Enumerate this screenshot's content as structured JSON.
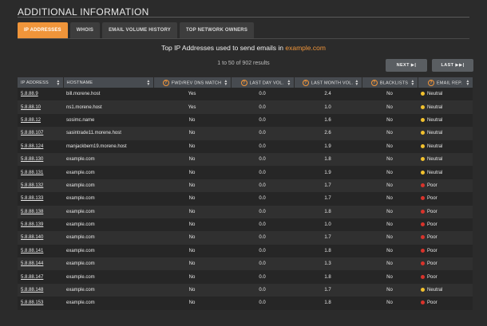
{
  "section_title": "ADDITIONAL INFORMATION",
  "tabs": [
    {
      "label": "IP ADDRESSES",
      "active": true
    },
    {
      "label": "WHOIS",
      "active": false
    },
    {
      "label": "EMAIL VOLUME HISTORY",
      "active": false
    },
    {
      "label": "TOP NETWORK OWNERS",
      "active": false
    }
  ],
  "headline": {
    "text": "Top IP Addresses used to send emails in ",
    "domain": "example.com"
  },
  "results_count": "1 to 50 of 902 results",
  "pager": {
    "next_label": "NEXT ▶|",
    "last_label": "LAST ▶▶|"
  },
  "columns": [
    "IP ADDRESS",
    "HOSTNAME",
    "FWD/REV DNS MATCH",
    "LAST DAY VOL.",
    "LAST MONTH VOL.",
    "BLACKLISTS",
    "EMAIL REP."
  ],
  "colors": {
    "accent": "#f0953a",
    "neutral": "#f2c12e",
    "poor": "#d9332b"
  },
  "rows": [
    {
      "ip": "5.8.88.9",
      "hostname": "bill.morene.host",
      "dns": "Yes",
      "day": "0.0",
      "month": "2.4",
      "blacklists": "No",
      "rep": "Neutral"
    },
    {
      "ip": "5.8.88.10",
      "hostname": "ns1.morene.host",
      "dns": "Yes",
      "day": "0.0",
      "month": "1.0",
      "blacklists": "No",
      "rep": "Neutral"
    },
    {
      "ip": "5.8.88.12",
      "hostname": "sosimc.name",
      "dns": "No",
      "day": "0.0",
      "month": "1.6",
      "blacklists": "No",
      "rep": "Neutral"
    },
    {
      "ip": "5.8.88.107",
      "hostname": "sasintrade11.morene.host",
      "dns": "No",
      "day": "0.0",
      "month": "2.6",
      "blacklists": "No",
      "rep": "Neutral"
    },
    {
      "ip": "5.8.88.124",
      "hostname": "manjackbem19.morene.host",
      "dns": "No",
      "day": "0.0",
      "month": "1.9",
      "blacklists": "No",
      "rep": "Neutral"
    },
    {
      "ip": "5.8.88.130",
      "hostname": "example.com",
      "dns": "No",
      "day": "0.0",
      "month": "1.8",
      "blacklists": "No",
      "rep": "Neutral"
    },
    {
      "ip": "5.8.88.131",
      "hostname": "example.com",
      "dns": "No",
      "day": "0.0",
      "month": "1.9",
      "blacklists": "No",
      "rep": "Neutral"
    },
    {
      "ip": "5.8.88.132",
      "hostname": "example.com",
      "dns": "No",
      "day": "0.0",
      "month": "1.7",
      "blacklists": "No",
      "rep": "Poor"
    },
    {
      "ip": "5.8.88.133",
      "hostname": "example.com",
      "dns": "No",
      "day": "0.0",
      "month": "1.7",
      "blacklists": "No",
      "rep": "Poor"
    },
    {
      "ip": "5.8.88.138",
      "hostname": "example.com",
      "dns": "No",
      "day": "0.0",
      "month": "1.8",
      "blacklists": "No",
      "rep": "Poor"
    },
    {
      "ip": "5.8.88.139",
      "hostname": "example.com",
      "dns": "No",
      "day": "0.0",
      "month": "1.0",
      "blacklists": "No",
      "rep": "Poor"
    },
    {
      "ip": "5.8.88.140",
      "hostname": "example.com",
      "dns": "No",
      "day": "0.0",
      "month": "1.7",
      "blacklists": "No",
      "rep": "Poor"
    },
    {
      "ip": "5.8.88.141",
      "hostname": "example.com",
      "dns": "No",
      "day": "0.0",
      "month": "1.8",
      "blacklists": "No",
      "rep": "Poor"
    },
    {
      "ip": "5.8.88.144",
      "hostname": "example.com",
      "dns": "No",
      "day": "0.0",
      "month": "1.3",
      "blacklists": "No",
      "rep": "Poor"
    },
    {
      "ip": "5.8.88.147",
      "hostname": "example.com",
      "dns": "No",
      "day": "0.0",
      "month": "1.8",
      "blacklists": "No",
      "rep": "Poor"
    },
    {
      "ip": "5.8.88.148",
      "hostname": "example.com",
      "dns": "No",
      "day": "0.0",
      "month": "1.7",
      "blacklists": "No",
      "rep": "Neutral"
    },
    {
      "ip": "5.8.88.153",
      "hostname": "example.com",
      "dns": "No",
      "day": "0.0",
      "month": "1.8",
      "blacklists": "No",
      "rep": "Poor"
    }
  ]
}
